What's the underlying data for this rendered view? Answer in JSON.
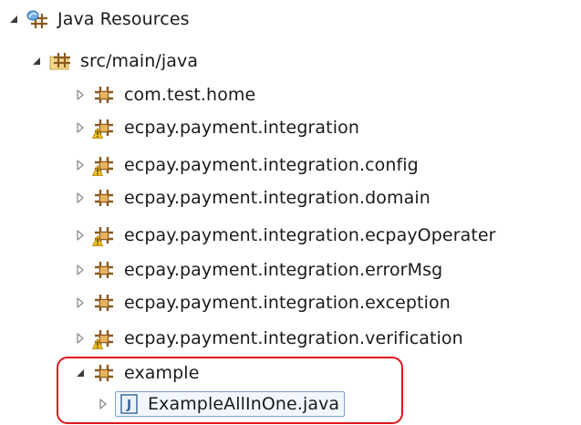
{
  "tree": {
    "root": {
      "label": "Java Resources",
      "expanded": true,
      "icon": "java-resources-icon"
    },
    "source_folder": {
      "label": "src/main/java",
      "expanded": true,
      "icon": "source-folder-icon"
    },
    "packages": [
      {
        "label": "com.test.home",
        "icon": "package-icon"
      },
      {
        "label": "ecpay.payment.integration",
        "icon": "package-warning-icon"
      },
      {
        "label": "ecpay.payment.integration.config",
        "icon": "package-warning-icon"
      },
      {
        "label": "ecpay.payment.integration.domain",
        "icon": "package-icon"
      },
      {
        "label": "ecpay.payment.integration.ecpayOperater",
        "icon": "package-warning-icon"
      },
      {
        "label": "ecpay.payment.integration.errorMsg",
        "icon": "package-icon"
      },
      {
        "label": "ecpay.payment.integration.exception",
        "icon": "package-icon"
      },
      {
        "label": "ecpay.payment.integration.verification",
        "icon": "package-warning-icon"
      }
    ],
    "example_package": {
      "label": "example",
      "expanded": true,
      "icon": "package-icon"
    },
    "example_file": {
      "label": "ExampleAllInOne.java",
      "icon": "java-file-icon",
      "selected": true
    }
  },
  "colors": {
    "highlight_border": "#e0141e",
    "selection_border": "#7da2ce",
    "package_brown": "#8a5a1e",
    "warning_yellow": "#f2c21b"
  }
}
